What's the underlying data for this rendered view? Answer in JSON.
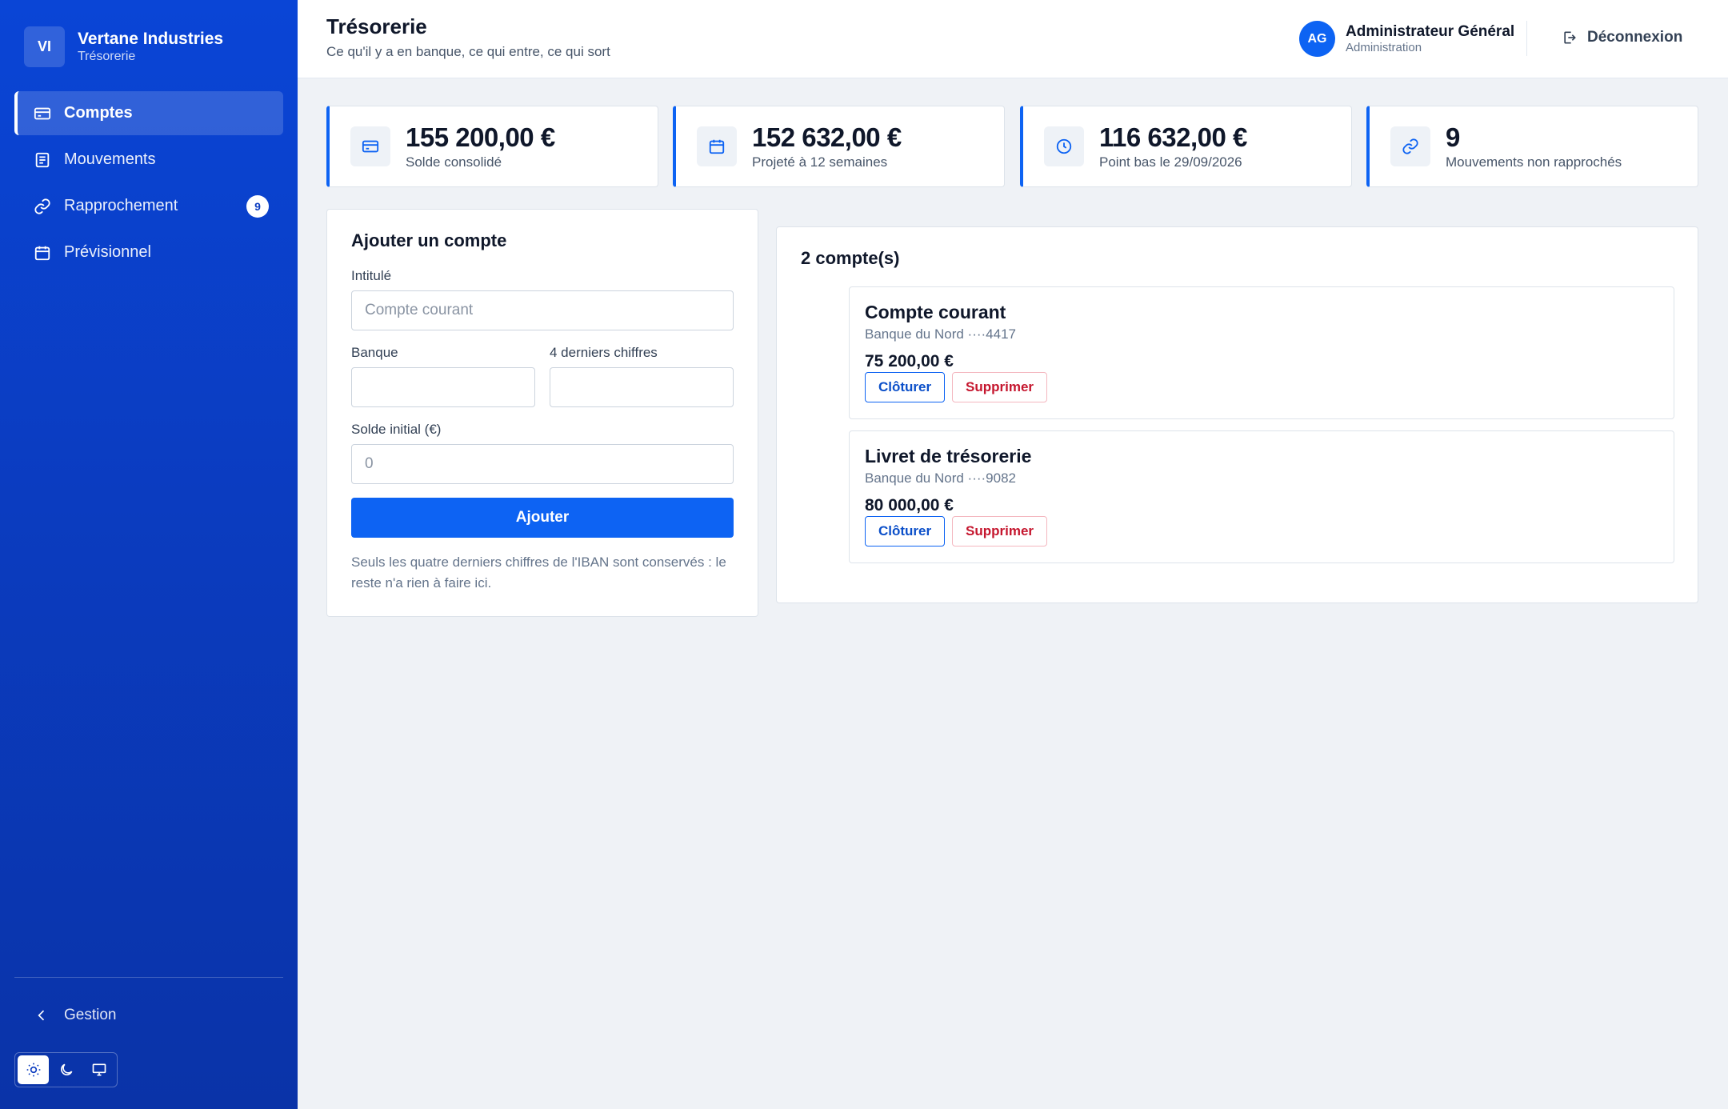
{
  "brand": {
    "initials": "VI",
    "name": "Vertane Industries",
    "module": "Trésorerie"
  },
  "nav": {
    "items": [
      {
        "label": "Comptes",
        "icon": "credit-card-icon",
        "active": true
      },
      {
        "label": "Mouvements",
        "icon": "list-icon"
      },
      {
        "label": "Rapprochement",
        "icon": "link-icon",
        "badge": "9"
      },
      {
        "label": "Prévisionnel",
        "icon": "calendar-icon"
      }
    ],
    "back_label": "Gestion"
  },
  "header": {
    "title": "Trésorerie",
    "subtitle": "Ce qu'il y a en banque, ce qui entre, ce qui sort",
    "user": {
      "initials": "AG",
      "name": "Administrateur Général",
      "role": "Administration"
    },
    "logout_label": "Déconnexion"
  },
  "kpis": [
    {
      "value": "155 200,00 €",
      "label": "Solde consolidé",
      "icon": "credit-card-icon"
    },
    {
      "value": "152 632,00 €",
      "label": "Projeté à 12 semaines",
      "icon": "calendar-icon"
    },
    {
      "value": "116 632,00 €",
      "label": "Point bas le 29/09/2026",
      "icon": "clock-icon"
    },
    {
      "value": "9",
      "label": "Mouvements non rapprochés",
      "icon": "link-icon"
    }
  ],
  "form": {
    "title": "Ajouter un compte",
    "intitule_label": "Intitulé",
    "intitule_placeholder": "Compte courant",
    "banque_label": "Banque",
    "banque_value": "",
    "digits_label": "4 derniers chiffres",
    "digits_value": "",
    "solde_label": "Solde initial (€)",
    "solde_placeholder": "0",
    "submit_label": "Ajouter",
    "note": "Seuls les quatre derniers chiffres de l'IBAN sont conservés : le reste n'a rien à faire ici."
  },
  "accounts": {
    "count_label": "2 compte(s)",
    "items": [
      {
        "name": "Compte courant",
        "meta": "Banque du Nord ····4417",
        "balance": "75 200,00 €"
      },
      {
        "name": "Livret de trésorerie",
        "meta": "Banque du Nord ····9082",
        "balance": "80 000,00 €"
      }
    ],
    "close_label": "Clôturer",
    "delete_label": "Supprimer"
  },
  "colors": {
    "primary": "#0d63f3",
    "sidebar": "#0b3cc0",
    "danger": "#c5162e"
  }
}
